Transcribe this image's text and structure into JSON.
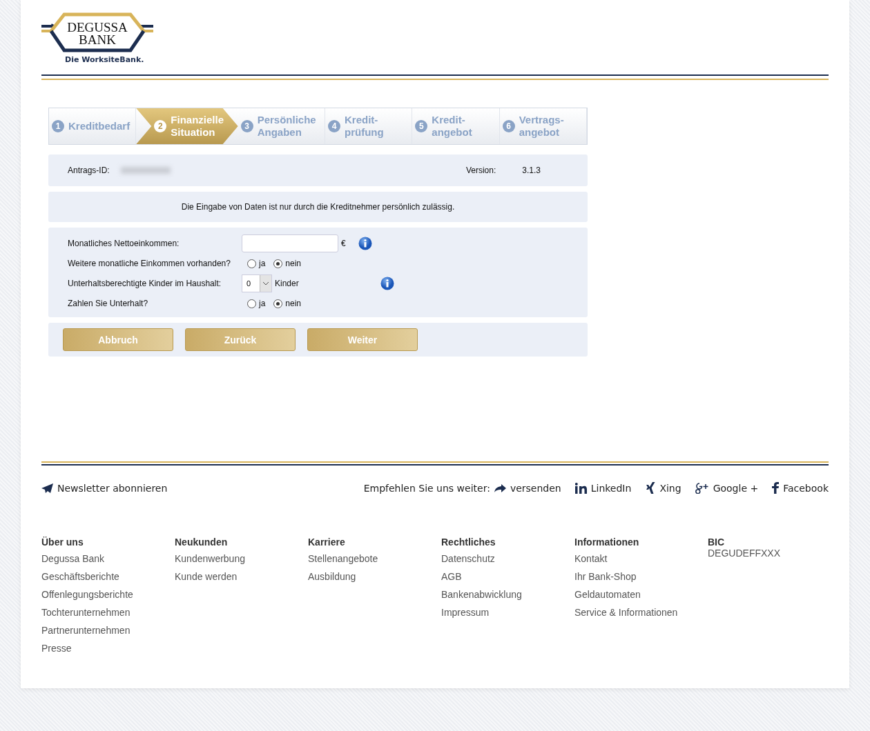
{
  "logo": {
    "line_1": "DEGUSSA",
    "line_2": "BANK",
    "tagline": "Die WorksiteBank."
  },
  "steps": [
    {
      "number": "1",
      "label": "Kreditbedarf",
      "selected": false
    },
    {
      "number": "2",
      "label": "Finanzielle Situation",
      "selected": true
    },
    {
      "number": "3",
      "label": "Persönliche Angaben",
      "selected": false
    },
    {
      "number": "4",
      "label": "Kredit-prüfung",
      "selected": false
    },
    {
      "number": "5",
      "label": "Kredit-angebot",
      "selected": false
    },
    {
      "number": "6",
      "label": "Vertrags-angebot",
      "selected": false
    }
  ],
  "info_bar": {
    "id_label": "Antrags-ID:",
    "version_label": "Version:",
    "version": "3.1.3"
  },
  "notice": "Die Eingabe von Daten ist nur durch die Kreditnehmer persönlich zulässig.",
  "form": [
    {
      "kind": "input",
      "label": "Monatliches Nettoeinkommen:",
      "unit": "€",
      "info": true
    },
    {
      "kind": "radio",
      "label": "Weitere monatliche Einkommen vorhanden?",
      "options": [
        {
          "label": "ja",
          "selected": false
        },
        {
          "label": "nein",
          "selected": true
        }
      ]
    },
    {
      "kind": "select",
      "label": "Unterhaltsberechtigte Kinder im Haushalt:",
      "value": "0",
      "unit": "Kinder",
      "info": true
    },
    {
      "kind": "radio",
      "label": "Zahlen Sie Unterhalt?",
      "options": [
        {
          "label": "ja",
          "selected": false
        },
        {
          "label": "nein",
          "selected": true
        }
      ]
    }
  ],
  "buttons": [
    "Abbruch",
    "Zurück",
    "Weiter"
  ],
  "footer": {
    "newsletter": "Newsletter abonnieren",
    "recommend": "Empfehlen Sie uns weiter:",
    "social": [
      {
        "kind": "share",
        "label": "versenden"
      },
      {
        "kind": "linkedin",
        "label": "LinkedIn"
      },
      {
        "kind": "xing",
        "label": "Xing"
      },
      {
        "kind": "google",
        "label": "Google +"
      },
      {
        "kind": "facebook",
        "label": "Facebook"
      }
    ],
    "columns": [
      {
        "title": "Über uns",
        "links": [
          "Degussa Bank",
          "Geschäftsberichte",
          "Offenlegungsberichte",
          "Tochterunternehmen",
          "Partnerunternehmen",
          "Presse"
        ]
      },
      {
        "title": "Neukunden",
        "links": [
          "Kundenwerbung",
          "Kunde werden"
        ]
      },
      {
        "title": "Karriere",
        "links": [
          "Stellenangebote",
          "Ausbildung"
        ]
      },
      {
        "title": "Rechtliches",
        "links": [
          "Datenschutz",
          "AGB",
          "Bankenabwicklung",
          "Impressum"
        ]
      },
      {
        "title": "Informationen",
        "links": [
          "Kontakt",
          "Ihr Bank-Shop",
          "Geldautomaten",
          "Service & Informationen"
        ]
      },
      {
        "title": "BIC",
        "text": "DEGUDEFFXXX"
      }
    ]
  }
}
